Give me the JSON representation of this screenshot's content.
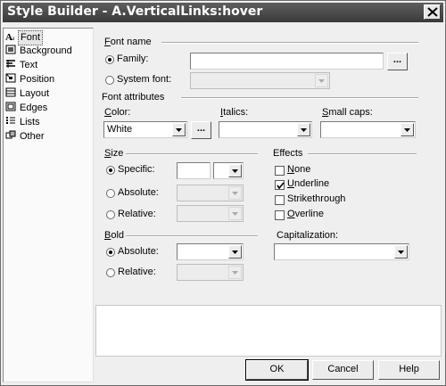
{
  "window": {
    "title": "Style Builder - A.VerticalLinks:hover"
  },
  "sidebar": {
    "items": [
      {
        "label": "Font",
        "icon": "font-a-icon"
      },
      {
        "label": "Background",
        "icon": "background-icon"
      },
      {
        "label": "Text",
        "icon": "text-icon"
      },
      {
        "label": "Position",
        "icon": "position-icon"
      },
      {
        "label": "Layout",
        "icon": "layout-icon"
      },
      {
        "label": "Edges",
        "icon": "edges-icon"
      },
      {
        "label": "Lists",
        "icon": "lists-icon"
      },
      {
        "label": "Other",
        "icon": "other-icon"
      }
    ]
  },
  "font_name": {
    "heading": "Font name",
    "family_label": "Family:",
    "family_value": "",
    "browse_label": "...",
    "system_font_label": "System font:",
    "system_font_value": ""
  },
  "font_attributes": {
    "heading": "Font attributes",
    "color_label": "Color:",
    "color_value": "White",
    "color_picker_label": "...",
    "italics_label": "Italics:",
    "italics_value": "",
    "small_caps_label": "Small caps:",
    "small_caps_value": ""
  },
  "size": {
    "heading": "Size",
    "specific_label": "Specific:",
    "absolute_label": "Absolute:",
    "relative_label": "Relative:"
  },
  "effects": {
    "heading": "Effects",
    "none_label": "None",
    "underline_label": "Underline",
    "strikethrough_label": "Strikethrough",
    "overline_label": "Overline",
    "underline_checked": true
  },
  "bold": {
    "heading": "Bold",
    "absolute_label": "Absolute:",
    "relative_label": "Relative:"
  },
  "capitalization": {
    "label": "Capitalization:",
    "value": ""
  },
  "buttons": {
    "ok": "OK",
    "cancel": "Cancel",
    "help": "Help"
  }
}
